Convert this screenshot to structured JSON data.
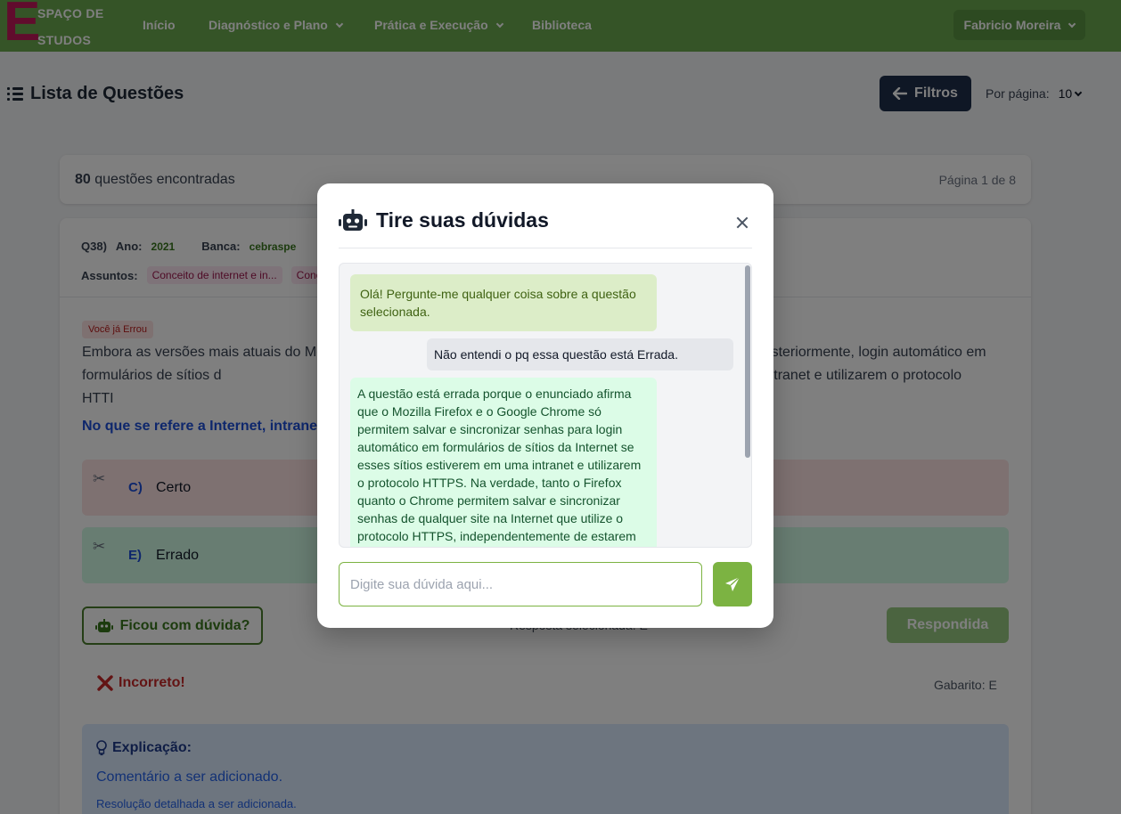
{
  "navbar": {
    "logo_letter": "E",
    "logo_line1": "SPAÇO DE",
    "logo_line2": "STUDOS",
    "items": [
      {
        "label": "Início"
      },
      {
        "label": "Diagnóstico e Plano"
      },
      {
        "label": "Prática e Execução"
      },
      {
        "label": "Biblioteca"
      }
    ],
    "user": "Fabricio Moreira"
  },
  "header": {
    "title": "Lista de Questões",
    "filters_label": "Filtros",
    "per_page_label": "Por página:",
    "per_page_value": "10"
  },
  "results": {
    "count": "80",
    "count_suffix": "questões encontradas",
    "page_info": "Página 1 de 8"
  },
  "question": {
    "number": "Q38)",
    "ano_label": "Ano:",
    "ano": "2021",
    "banca_label": "Banca:",
    "banca": "cebraspe",
    "assuntos_label": "Assuntos:",
    "assuntos": [
      "Conceito de internet e in...",
      "Conc"
    ],
    "badge": "Você já Errou",
    "text": "Embora as versões mais atuais do Mo                                                                                         ara realizar, posteriormente, login automático em formulários de sítios d                                                                                       erem disponibilizados em uma intranet e utilizarem o protocolo HTTI",
    "command": "No que se refere a Internet, intranet                                                                                        em.",
    "options": [
      {
        "letter": "C)",
        "text": "Certo"
      },
      {
        "letter": "E)",
        "text": "Errado"
      }
    ],
    "doubt_button": "Ficou com dúvida?",
    "selected_text": "Resposta selecionada: E",
    "answered_button": "Respondida",
    "result": "Incorreto!",
    "gabarito": "Gabarito: E",
    "explanation_title": "Explicação:",
    "explanation_comment": "Comentário a ser adicionado.",
    "explanation_resolution": "Resolução detalhada a ser adicionada."
  },
  "modal": {
    "title": "Tire suas dúvidas",
    "messages": [
      {
        "from": "bot",
        "text": "Olá! Pergunte-me qualquer coisa sobre a questão selecionada."
      },
      {
        "from": "user",
        "text": "Não entendi o pq essa questão está Errada."
      },
      {
        "from": "bot",
        "text": "A questão está errada porque o enunciado afirma que o Mozilla Firefox e o Google Chrome só permitem salvar e sincronizar senhas para login automático em formulários de sítios da Internet se esses sítios estiverem em uma intranet e utilizarem o protocolo HTTPS. Na verdade, tanto o Firefox quanto o Chrome permitem salvar e sincronizar senhas de qualquer site na Internet que utilize o protocolo HTTPS, independentemente de estarem em uma"
      }
    ],
    "input_placeholder": "Digite sua dúvida aqui..."
  },
  "colors": {
    "navbar": "#6aa84f",
    "accent": "#7cb342",
    "logo": "#c2185b",
    "filters_button": "#1f2f4a"
  }
}
